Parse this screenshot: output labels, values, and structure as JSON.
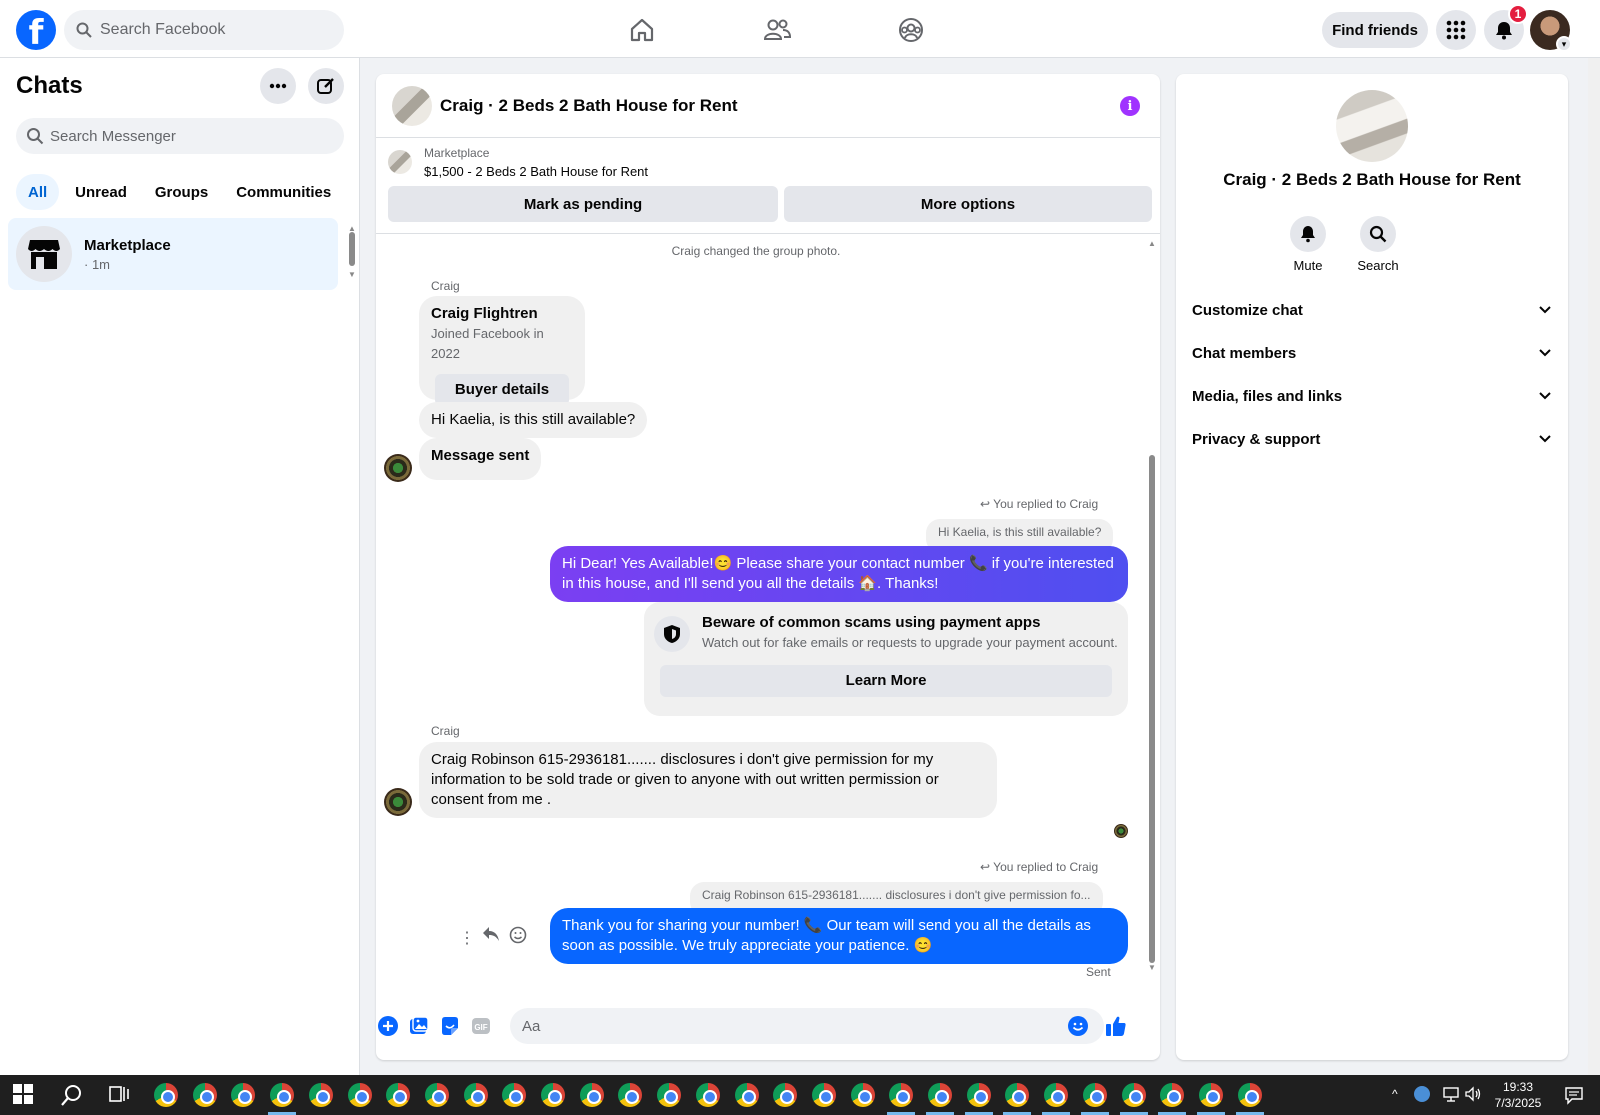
{
  "topbar": {
    "search_placeholder": "Search Facebook",
    "find_friends": "Find friends",
    "notification_count": "1",
    "nav_icons": [
      "home-icon",
      "friends-icon",
      "groups-icon"
    ]
  },
  "sidebar": {
    "title": "Chats",
    "search_placeholder": "Search Messenger",
    "filters": [
      "All",
      "Unread",
      "Groups",
      "Communities"
    ],
    "active_filter": "All",
    "chats": [
      {
        "name": "Marketplace",
        "time": "· 1m"
      }
    ]
  },
  "conversation": {
    "title": "Craig · 2 Beds 2 Bath House for Rent",
    "marketplace_label": "Marketplace",
    "listing": "$1,500 - 2 Beds 2 Bath House for Rent",
    "mark_pending": "Mark as pending",
    "more_options": "More options",
    "system_message": "Craig changed the group photo.",
    "sender_name": "Craig",
    "profile_card": {
      "name": "Craig Flightren",
      "joined": "Joined Facebook in 2022",
      "button": "Buyer details"
    },
    "msg_in_1": "Hi Kaelia, is this still available?",
    "msg_in_2": "Message sent",
    "reply_label_1": "You replied to Craig",
    "quote_1": "Hi Kaelia, is this still available?",
    "msg_out_1": "Hi Dear! Yes Available!😊 Please share your contact number 📞 if you're interested in this house, and I'll send you all the details 🏠. Thanks!",
    "scam_card": {
      "title": "Beware of common scams using payment apps",
      "body": "Watch out for fake emails or requests to upgrade your payment account.",
      "button": "Learn More"
    },
    "sender_name_2": "Craig",
    "msg_in_3": "Craig Robinson 615-2936181....... disclosures i don't give permission for my information to be sold trade or given to anyone with out written permission or consent from me .",
    "reply_label_2": "You replied to Craig",
    "quote_2": "Craig Robinson 615-2936181....... disclosures i don't give permission fo...",
    "msg_out_2": "Thank you for sharing your number! 📞 Our team will send you all the details as soon as possible. We truly appreciate your patience. 😊",
    "status": "Sent",
    "composer_placeholder": "Aa"
  },
  "details": {
    "title": "Craig · 2 Beds 2 Bath House for Rent",
    "mute": "Mute",
    "search": "Search",
    "sections": [
      "Customize chat",
      "Chat members",
      "Media, files and links",
      "Privacy & support"
    ]
  },
  "taskbar": {
    "time": "19:33",
    "date": "7/3/2025"
  },
  "colors": {
    "brand": "#0866ff",
    "outgoing_gradient_start": "#7b3ff2",
    "outgoing_blue": "#0866ff",
    "active_chat_bg": "#ebf5ff",
    "info_purple": "#a033ff"
  }
}
